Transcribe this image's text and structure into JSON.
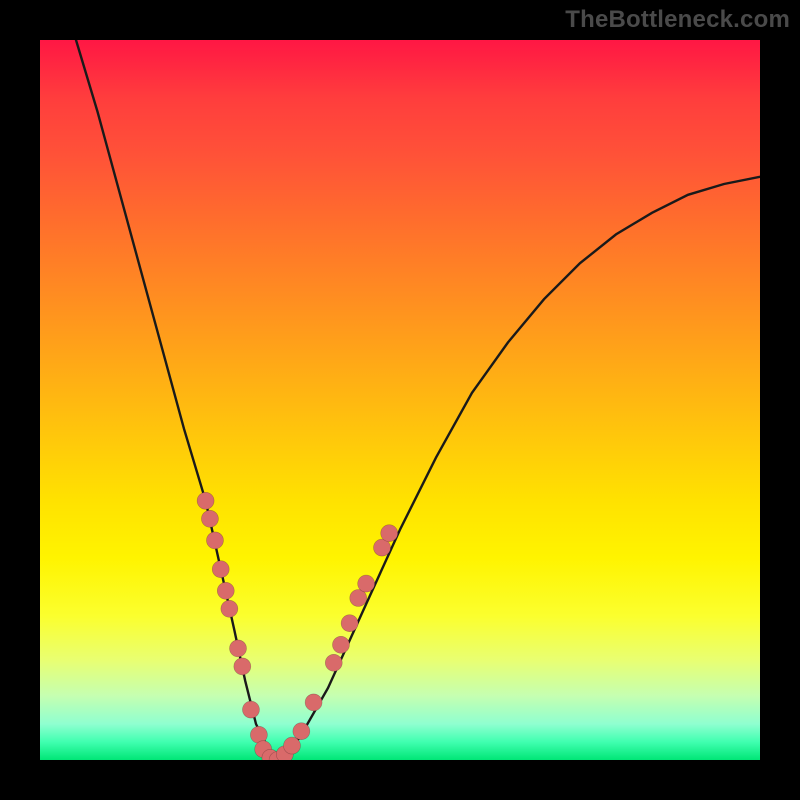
{
  "watermark": "TheBottleneck.com",
  "chart_data": {
    "type": "line",
    "title": "",
    "xlabel": "",
    "ylabel": "",
    "xlim": [
      0,
      100
    ],
    "ylim": [
      0,
      100
    ],
    "grid": false,
    "legend": "none",
    "series": [
      {
        "name": "curve",
        "x": [
          5,
          8,
          11,
          14,
          17,
          20,
          23,
          25,
          27,
          28.5,
          30,
          31.5,
          33,
          36,
          40,
          45,
          50,
          55,
          60,
          65,
          70,
          75,
          80,
          85,
          90,
          95,
          100
        ],
        "y": [
          100,
          90,
          79,
          68,
          57,
          46,
          36,
          27,
          18,
          11,
          5,
          2,
          0,
          3,
          10,
          21,
          32,
          42,
          51,
          58,
          64,
          69,
          73,
          76,
          78.5,
          80,
          81
        ]
      }
    ],
    "points": [
      {
        "x": 23.0,
        "y": 36.0
      },
      {
        "x": 23.6,
        "y": 33.5
      },
      {
        "x": 24.3,
        "y": 30.5
      },
      {
        "x": 25.1,
        "y": 26.5
      },
      {
        "x": 25.8,
        "y": 23.5
      },
      {
        "x": 26.3,
        "y": 21.0
      },
      {
        "x": 27.5,
        "y": 15.5
      },
      {
        "x": 28.1,
        "y": 13.0
      },
      {
        "x": 29.3,
        "y": 7.0
      },
      {
        "x": 30.4,
        "y": 3.5
      },
      {
        "x": 31.0,
        "y": 1.5
      },
      {
        "x": 32.0,
        "y": 0.3
      },
      {
        "x": 33.0,
        "y": 0.0
      },
      {
        "x": 34.0,
        "y": 0.8
      },
      {
        "x": 35.0,
        "y": 2.0
      },
      {
        "x": 36.3,
        "y": 4.0
      },
      {
        "x": 38.0,
        "y": 8.0
      },
      {
        "x": 40.8,
        "y": 13.5
      },
      {
        "x": 41.8,
        "y": 16.0
      },
      {
        "x": 43.0,
        "y": 19.0
      },
      {
        "x": 44.2,
        "y": 22.5
      },
      {
        "x": 45.3,
        "y": 24.5
      },
      {
        "x": 47.5,
        "y": 29.5
      },
      {
        "x": 48.5,
        "y": 31.5
      }
    ],
    "colors": {
      "gradient_top": "#ff1744",
      "gradient_bottom": "#00e676",
      "curve": "#1a1a1a",
      "dots": "#d96a6a",
      "background": "#000000"
    }
  }
}
